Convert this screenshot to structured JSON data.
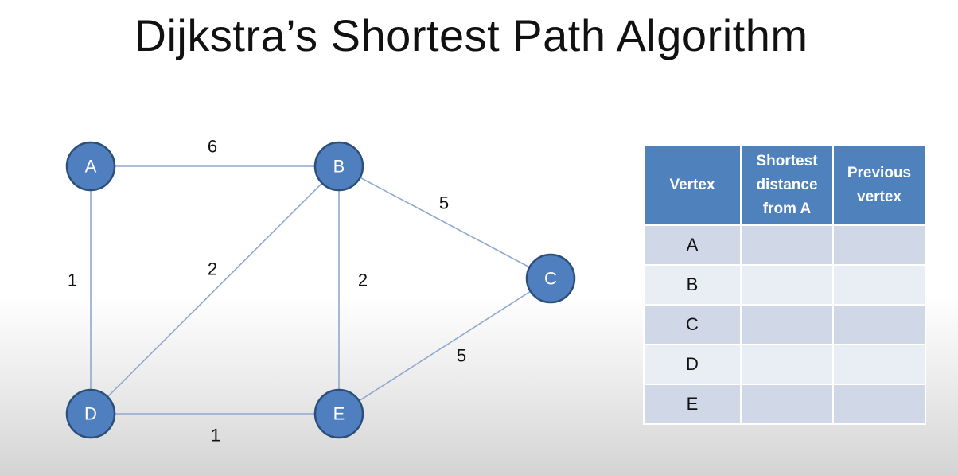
{
  "title": "Dijkstra’s Shortest Path Algorithm",
  "graph": {
    "nodes": [
      {
        "id": "A"
      },
      {
        "id": "B"
      },
      {
        "id": "C"
      },
      {
        "id": "D"
      },
      {
        "id": "E"
      }
    ],
    "edges": [
      {
        "from": "A",
        "to": "B",
        "weight": "6"
      },
      {
        "from": "A",
        "to": "D",
        "weight": "1"
      },
      {
        "from": "B",
        "to": "D",
        "weight": "2"
      },
      {
        "from": "B",
        "to": "E",
        "weight": "2"
      },
      {
        "from": "B",
        "to": "C",
        "weight": "5"
      },
      {
        "from": "D",
        "to": "E",
        "weight": "1"
      },
      {
        "from": "E",
        "to": "C",
        "weight": "5"
      }
    ],
    "colors": {
      "node_fill": "#4f7fbf",
      "node_stroke": "#2c4f7a",
      "edge": "#8fa8cf"
    }
  },
  "table": {
    "headers": {
      "vertex": "Vertex",
      "distance": [
        "Shortest",
        "distance",
        "from A"
      ],
      "previous": [
        "Previous",
        "vertex"
      ]
    },
    "rows": [
      {
        "vertex": "A",
        "distance": "",
        "previous": ""
      },
      {
        "vertex": "B",
        "distance": "",
        "previous": ""
      },
      {
        "vertex": "C",
        "distance": "",
        "previous": ""
      },
      {
        "vertex": "D",
        "distance": "",
        "previous": ""
      },
      {
        "vertex": "E",
        "distance": "",
        "previous": ""
      }
    ],
    "colors": {
      "header": "#4f81bd",
      "row_odd": "#d0d8e8",
      "row_even": "#e9edf4"
    }
  }
}
